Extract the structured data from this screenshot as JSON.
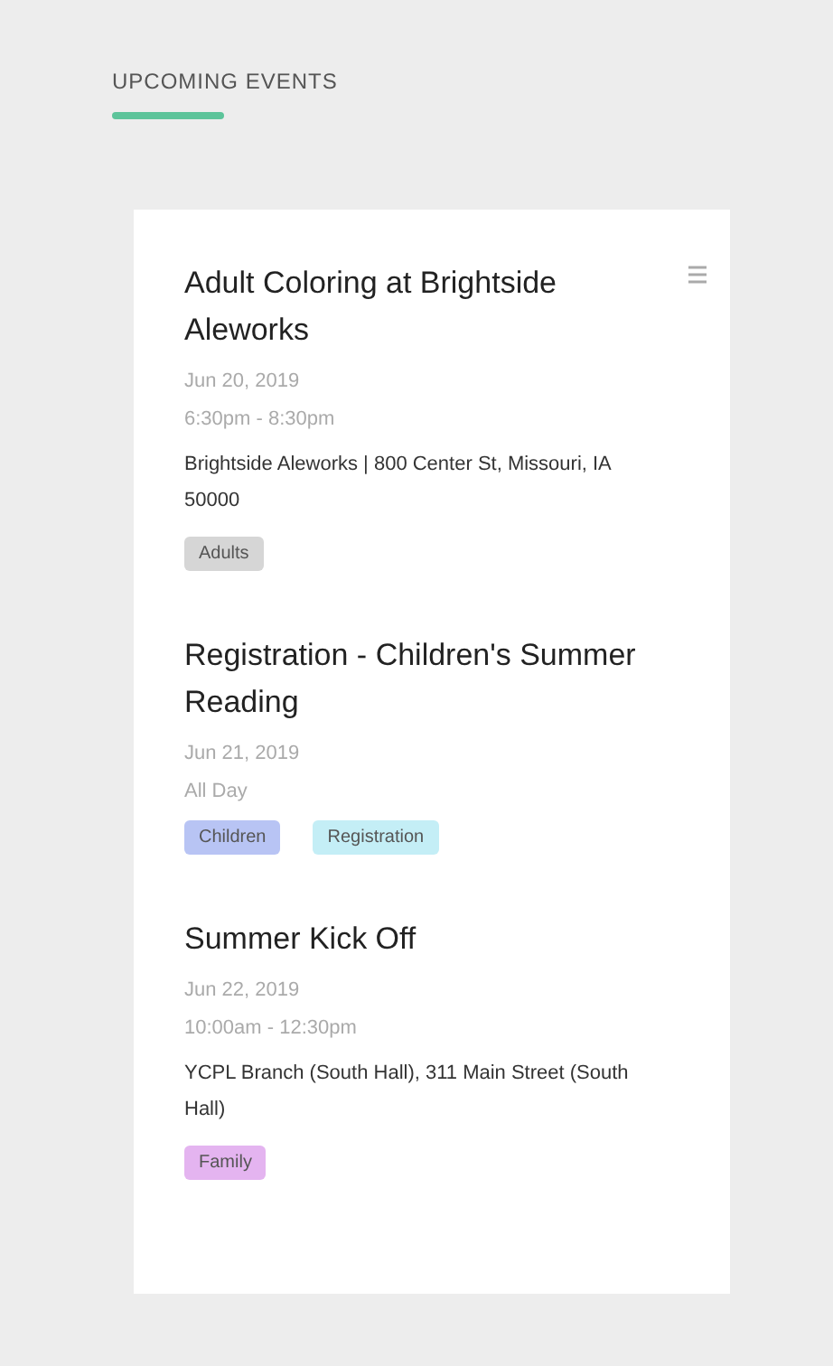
{
  "heading": "UPCOMING EVENTS",
  "events": [
    {
      "title": "Adult Coloring at Brightside Aleworks",
      "date": "Jun 20, 2019",
      "time": "6:30pm - 8:30pm",
      "location": "Brightside Aleworks | 800 Center St, Missouri, IA 50000",
      "tags": [
        {
          "label": "Adults",
          "color": "#d6d6d6"
        }
      ]
    },
    {
      "title": "Registration - Children's Summer Reading",
      "date": "Jun 21, 2019",
      "time": "All Day",
      "tags": [
        {
          "label": "Children",
          "color": "#b8c4f4"
        },
        {
          "label": "Registration",
          "color": "#c4eef6"
        }
      ]
    },
    {
      "title": "Summer Kick Off",
      "date": "Jun 22, 2019",
      "time": "10:00am - 12:30pm",
      "location": "YCPL Branch (South Hall), 311 Main Street (South Hall)",
      "tags": [
        {
          "label": "Family",
          "color": "#e4b4f0"
        }
      ]
    }
  ]
}
